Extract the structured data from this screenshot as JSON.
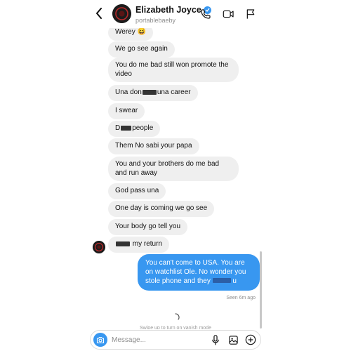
{
  "header": {
    "title": "Elizabeth Joyce",
    "username": "portablebaeby",
    "verified": true,
    "icons": [
      "back-icon",
      "phone-icon",
      "video-icon",
      "flag-icon"
    ]
  },
  "messages": [
    {
      "sender": "them",
      "text": "Werey 😆"
    },
    {
      "sender": "them",
      "text": "We go see again"
    },
    {
      "sender": "them",
      "text": "You do me bad still won promote the video"
    },
    {
      "sender": "them",
      "text_before": "Una don",
      "text_after": "una career",
      "redacted": true
    },
    {
      "sender": "them",
      "text": "I swear"
    },
    {
      "sender": "them",
      "text_before": "D",
      "text_after": "people",
      "redacted": true
    },
    {
      "sender": "them",
      "text": "Them No sabi your papa"
    },
    {
      "sender": "them",
      "text": "You and your brothers do me bad and run away"
    },
    {
      "sender": "them",
      "text": "God pass una"
    },
    {
      "sender": "them",
      "text": "One day is coming we go see"
    },
    {
      "sender": "them",
      "text": "Your body go tell you"
    },
    {
      "sender": "them",
      "text_before": "",
      "text_after": "my return",
      "redacted": true
    },
    {
      "sender": "me",
      "text_before": "You can't come to USA. You are on watchlist Ole. No wonder you stole phone and they",
      "text_after": "u",
      "redacted": true
    }
  ],
  "seen_label": "Seen 6m ago",
  "vanish_hint": "Swipe up to turn on vanish mode",
  "composer": {
    "placeholder": "Message...",
    "icons": [
      "camera-icon",
      "microphone-icon",
      "gallery-icon",
      "add-icon"
    ]
  },
  "colors": {
    "accent": "#3897f0",
    "incoming_bubble": "#efefef",
    "muted_text": "#8e8e8e"
  }
}
